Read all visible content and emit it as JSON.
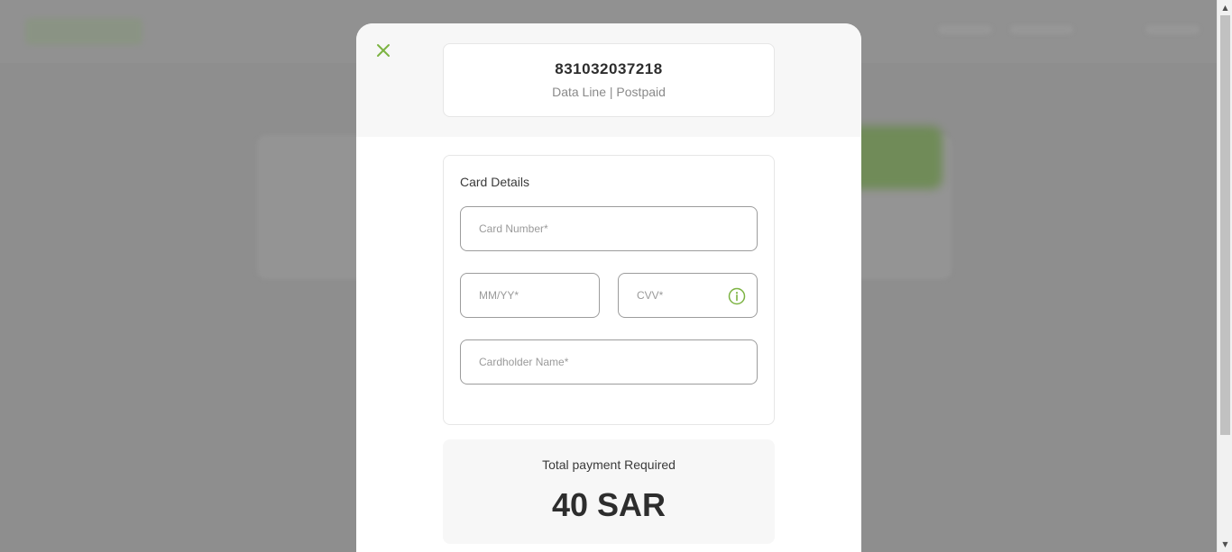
{
  "line": {
    "number": "831032037218",
    "type": "Data Line | Postpaid"
  },
  "card_details": {
    "title": "Card Details",
    "card_number_placeholder": "Card Number*",
    "expiry_placeholder": "MM/YY*",
    "cvv_placeholder": "CVV*",
    "cardholder_placeholder": "Cardholder Name*"
  },
  "payment": {
    "label": "Total payment Required",
    "amount": "40 SAR"
  },
  "icons": {
    "close": "close-icon",
    "info": "info-icon",
    "scroll_up": "scroll-up-arrow",
    "scroll_down": "scroll-down-arrow"
  },
  "colors": {
    "accent": "#7cb342",
    "overlay": "#8e8e8e",
    "text_dark": "#2d2d2d",
    "text_muted": "#8a8a8a"
  }
}
